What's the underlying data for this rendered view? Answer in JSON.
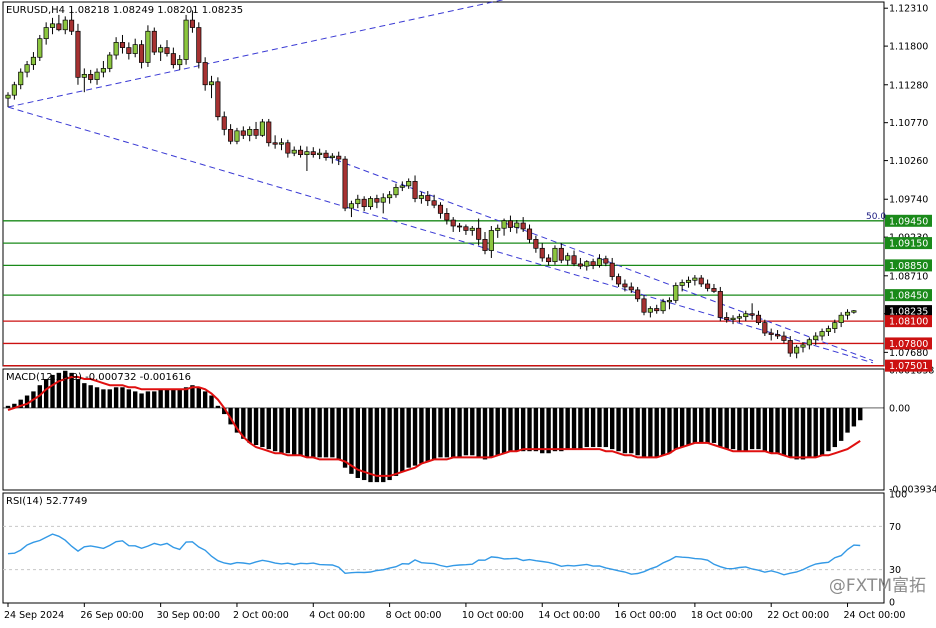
{
  "colors": {
    "background": "#ffffff",
    "frame": "#000000",
    "grid": "#c8c8c8",
    "bull_candle": "#8cc63f",
    "bear_candle": "#a63232",
    "wick": "#000000",
    "trend_channel": "#3a3ad4",
    "support_line": "#1a8a1a",
    "resistance_line": "#cc1111",
    "macd_hist": "#000000",
    "macd_signal": "#e01010",
    "rsi_line": "#3399e6",
    "tag_green": "#1a8a1a",
    "tag_red": "#cc1111",
    "tag_dark": "#000000"
  },
  "main_panel": {
    "header": "EURUSD,H4  1.08218 1.08249 1.08201 1.08235",
    "fib_label": "50.0",
    "ylim": [
      1.0751,
      1.1238
    ]
  },
  "macd_panel": {
    "header": "MACD(12,26,9) -0.000732 -0.001616",
    "axis_labels": [
      "0.001838",
      "0.00",
      "-0.003934"
    ]
  },
  "rsi_panel": {
    "header": "RSI(14) 52.7749",
    "axis_labels": [
      "100",
      "70",
      "30",
      "0"
    ]
  },
  "price_axis_labels": [
    "1.12310",
    "1.11800",
    "1.11280",
    "1.10770",
    "1.10260",
    "1.09740",
    "1.09230",
    "1.08710",
    "1.08200",
    "1.07680"
  ],
  "price_tags": [
    {
      "label": "1.09450",
      "style": "green"
    },
    {
      "label": "1.09150",
      "style": "green"
    },
    {
      "label": "1.08850",
      "style": "green"
    },
    {
      "label": "1.08450",
      "style": "green"
    },
    {
      "label": "1.08235",
      "style": "dark"
    },
    {
      "label": "1.08100",
      "style": "red"
    },
    {
      "label": "1.07800",
      "style": "red"
    },
    {
      "label": "1.07501",
      "style": "red"
    }
  ],
  "time_labels": [
    "24 Sep 2024",
    "26 Sep 00:00",
    "30 Sep 00:00",
    "2 Oct 00:00",
    "4 Oct 00:00",
    "8 Oct 00:00",
    "10 Oct 00:00",
    "14 Oct 00:00",
    "16 Oct 00:00",
    "18 Oct 00:00",
    "22 Oct 00:00",
    "24 Oct 00:00"
  ],
  "watermark": "@FXTM富拓",
  "chart_data": {
    "type": "candlestick",
    "symbol": "EURUSD",
    "timeframe": "H4",
    "levels": {
      "green": [
        1.0945,
        1.0915,
        1.0885,
        1.0845
      ],
      "red": [
        1.081,
        1.078,
        1.07501
      ]
    },
    "trend_channel": {
      "upper_start": [
        0,
        1.0902
      ],
      "upper_slope": -0.000159,
      "lower_start": [
        0,
        1.1098
      ],
      "lower_slope": -0.000253,
      "support_line_start": [
        0,
        1.1098
      ],
      "support_line_end": [
        82,
        1.125
      ]
    },
    "candles": [
      [
        1.111,
        1.1118,
        1.1098,
        1.1114
      ],
      [
        1.1114,
        1.1132,
        1.1108,
        1.1128
      ],
      [
        1.1128,
        1.115,
        1.1122,
        1.1145
      ],
      [
        1.1145,
        1.116,
        1.1138,
        1.1155
      ],
      [
        1.1155,
        1.1172,
        1.1148,
        1.1165
      ],
      [
        1.1165,
        1.1195,
        1.116,
        1.119
      ],
      [
        1.119,
        1.1212,
        1.1182,
        1.1205
      ],
      [
        1.1205,
        1.1218,
        1.1196,
        1.121
      ],
      [
        1.121,
        1.1222,
        1.12,
        1.1202
      ],
      [
        1.1202,
        1.122,
        1.1196,
        1.1215
      ],
      [
        1.1215,
        1.1228,
        1.1195,
        1.12
      ],
      [
        1.12,
        1.121,
        1.1128,
        1.1138
      ],
      [
        1.1138,
        1.115,
        1.1118,
        1.1142
      ],
      [
        1.1142,
        1.1148,
        1.113,
        1.1135
      ],
      [
        1.1135,
        1.115,
        1.1128,
        1.1145
      ],
      [
        1.1145,
        1.116,
        1.1138,
        1.115
      ],
      [
        1.115,
        1.1172,
        1.1145,
        1.1168
      ],
      [
        1.1168,
        1.1192,
        1.1162,
        1.1185
      ],
      [
        1.1185,
        1.1195,
        1.117,
        1.1178
      ],
      [
        1.1178,
        1.1185,
        1.1162,
        1.117
      ],
      [
        1.117,
        1.119,
        1.1165,
        1.1182
      ],
      [
        1.1182,
        1.1188,
        1.115,
        1.1158
      ],
      [
        1.1158,
        1.1208,
        1.1152,
        1.12
      ],
      [
        1.12,
        1.1205,
        1.1168,
        1.1172
      ],
      [
        1.1172,
        1.1182,
        1.116,
        1.1178
      ],
      [
        1.1178,
        1.1188,
        1.1166,
        1.117
      ],
      [
        1.117,
        1.1178,
        1.115,
        1.1155
      ],
      [
        1.1155,
        1.1168,
        1.1148,
        1.1162
      ],
      [
        1.1162,
        1.1222,
        1.1155,
        1.1215
      ],
      [
        1.1215,
        1.1228,
        1.1198,
        1.1205
      ],
      [
        1.1205,
        1.1212,
        1.115,
        1.1158
      ],
      [
        1.1158,
        1.1165,
        1.112,
        1.1128
      ],
      [
        1.1128,
        1.114,
        1.111,
        1.1132
      ],
      [
        1.1132,
        1.1138,
        1.108,
        1.1085
      ],
      [
        1.1085,
        1.1092,
        1.106,
        1.1068
      ],
      [
        1.1068,
        1.1075,
        1.1048,
        1.1052
      ],
      [
        1.1052,
        1.107,
        1.1048,
        1.1066
      ],
      [
        1.1066,
        1.1072,
        1.1055,
        1.106
      ],
      [
        1.106,
        1.1072,
        1.1052,
        1.1068
      ],
      [
        1.1068,
        1.1078,
        1.1055,
        1.106
      ],
      [
        1.106,
        1.1082,
        1.1058,
        1.1078
      ],
      [
        1.1078,
        1.1082,
        1.1045,
        1.105
      ],
      [
        1.105,
        1.106,
        1.1042,
        1.1048
      ],
      [
        1.1048,
        1.1056,
        1.104,
        1.105
      ],
      [
        1.105,
        1.1054,
        1.103,
        1.1036
      ],
      [
        1.1036,
        1.1045,
        1.1032,
        1.104
      ],
      [
        1.104,
        1.1046,
        1.103,
        1.1034
      ],
      [
        1.1034,
        1.1045,
        1.1012,
        1.1038
      ],
      [
        1.1038,
        1.1044,
        1.103,
        1.1034
      ],
      [
        1.1034,
        1.1042,
        1.1028,
        1.1036
      ],
      [
        1.1036,
        1.104,
        1.1026,
        1.103
      ],
      [
        1.103,
        1.1036,
        1.1022,
        1.1032
      ],
      [
        1.1032,
        1.1038,
        1.102,
        1.1028
      ],
      [
        1.1028,
        1.1032,
        1.0958,
        1.0962
      ],
      [
        1.0962,
        1.0972,
        1.095,
        1.0968
      ],
      [
        1.0968,
        1.098,
        1.0962,
        1.0974
      ],
      [
        1.0974,
        1.0978,
        1.0958,
        1.0964
      ],
      [
        1.0964,
        1.0978,
        1.096,
        1.0975
      ],
      [
        1.0975,
        1.098,
        1.0962,
        1.097
      ],
      [
        1.097,
        1.0982,
        1.0955,
        1.0976
      ],
      [
        1.0976,
        1.0985,
        1.0968,
        1.098
      ],
      [
        1.098,
        1.0995,
        1.0976,
        1.099
      ],
      [
        1.099,
        1.0998,
        1.0985,
        1.0992
      ],
      [
        1.0992,
        1.1002,
        1.0988,
        1.0998
      ],
      [
        1.0998,
        1.1006,
        1.097,
        1.0975
      ],
      [
        1.0975,
        1.0984,
        1.0968,
        1.0979
      ],
      [
        1.0979,
        1.0985,
        1.0965,
        1.0972
      ],
      [
        1.0972,
        1.098,
        1.0962,
        1.0966
      ],
      [
        1.0966,
        1.097,
        1.0948,
        1.0955
      ],
      [
        1.0955,
        1.0962,
        1.094,
        1.0946
      ],
      [
        1.0946,
        1.095,
        1.093,
        1.0938
      ],
      [
        1.0938,
        1.0942,
        1.093,
        1.0937
      ],
      [
        1.0937,
        1.094,
        1.0926,
        1.0932
      ],
      [
        1.0932,
        1.0938,
        1.0925,
        1.0935
      ],
      [
        1.0935,
        1.0948,
        1.0912,
        1.092
      ],
      [
        1.092,
        1.093,
        1.09,
        1.0905
      ],
      [
        1.0905,
        1.0938,
        1.0895,
        1.0932
      ],
      [
        1.0932,
        1.094,
        1.0922,
        1.0935
      ],
      [
        1.0935,
        1.0948,
        1.0925,
        1.0945
      ],
      [
        1.0945,
        1.0952,
        1.093,
        1.0936
      ],
      [
        1.0936,
        1.0946,
        1.0928,
        1.0942
      ],
      [
        1.0942,
        1.095,
        1.093,
        1.0934
      ],
      [
        1.0934,
        1.094,
        1.0915,
        1.092
      ],
      [
        1.092,
        1.0925,
        1.0902,
        1.0908
      ],
      [
        1.0908,
        1.0915,
        1.089,
        1.0895
      ],
      [
        1.0895,
        1.09,
        1.0885,
        1.089
      ],
      [
        1.089,
        1.0912,
        1.0886,
        1.0908
      ],
      [
        1.0908,
        1.0915,
        1.0888,
        1.0892
      ],
      [
        1.0892,
        1.0902,
        1.0885,
        1.0898
      ],
      [
        1.0898,
        1.0905,
        1.0884,
        1.0887
      ],
      [
        1.0887,
        1.0895,
        1.088,
        1.0884
      ],
      [
        1.0884,
        1.0892,
        1.0878,
        1.089
      ],
      [
        1.089,
        1.0894,
        1.088,
        1.0885
      ],
      [
        1.0885,
        1.09,
        1.0882,
        1.0894
      ],
      [
        1.0894,
        1.0898,
        1.0884,
        1.0888
      ],
      [
        1.0888,
        1.0895,
        1.0865,
        1.087
      ],
      [
        1.087,
        1.0874,
        1.0856,
        1.086
      ],
      [
        1.086,
        1.0866,
        1.085,
        1.0856
      ],
      [
        1.0856,
        1.0862,
        1.0848,
        1.0852
      ],
      [
        1.0852,
        1.0856,
        1.0836,
        1.084
      ],
      [
        1.084,
        1.0845,
        1.0818,
        1.0822
      ],
      [
        1.0822,
        1.083,
        1.0815,
        1.0827
      ],
      [
        1.0827,
        1.0832,
        1.082,
        1.0824
      ],
      [
        1.0824,
        1.084,
        1.082,
        1.0836
      ],
      [
        1.0836,
        1.0842,
        1.0826,
        1.0838
      ],
      [
        1.0838,
        1.0862,
        1.0834,
        1.0858
      ],
      [
        1.0858,
        1.0866,
        1.085,
        1.0862
      ],
      [
        1.0862,
        1.087,
        1.0855,
        1.0865
      ],
      [
        1.0865,
        1.0872,
        1.0858,
        1.0868
      ],
      [
        1.0868,
        1.0872,
        1.0856,
        1.086
      ],
      [
        1.086,
        1.0866,
        1.085,
        1.0854
      ],
      [
        1.0854,
        1.086,
        1.0848,
        1.085
      ],
      [
        1.085,
        1.0856,
        1.081,
        1.0815
      ],
      [
        1.0815,
        1.0822,
        1.0808,
        1.0812
      ],
      [
        1.0812,
        1.0818,
        1.0806,
        1.0814
      ],
      [
        1.0814,
        1.082,
        1.0808,
        1.0816
      ],
      [
        1.0816,
        1.0824,
        1.081,
        1.082
      ],
      [
        1.082,
        1.0834,
        1.0812,
        1.0818
      ],
      [
        1.0818,
        1.0824,
        1.0805,
        1.0808
      ],
      [
        1.0808,
        1.0812,
        1.079,
        1.0794
      ],
      [
        1.0794,
        1.08,
        1.0784,
        1.0792
      ],
      [
        1.0792,
        1.0798,
        1.0786,
        1.079
      ],
      [
        1.079,
        1.0796,
        1.078,
        1.0784
      ],
      [
        1.0784,
        1.079,
        1.0762,
        1.0767
      ],
      [
        1.0767,
        1.0778,
        1.076,
        1.0775
      ],
      [
        1.0775,
        1.0782,
        1.0768,
        1.0778
      ],
      [
        1.0778,
        1.0788,
        1.0772,
        1.0785
      ],
      [
        1.0785,
        1.0795,
        1.0778,
        1.079
      ],
      [
        1.079,
        1.08,
        1.0784,
        1.0796
      ],
      [
        1.0796,
        1.0804,
        1.079,
        1.08
      ],
      [
        1.08,
        1.0812,
        1.0794,
        1.0808
      ],
      [
        1.0808,
        1.0822,
        1.0802,
        1.0818
      ],
      [
        1.0818,
        1.0826,
        1.0812,
        1.0822
      ],
      [
        1.0822,
        1.0825,
        1.082,
        1.0824
      ]
    ],
    "macd_hist": [
      0.0001,
      0.0002,
      0.0004,
      0.0006,
      0.0008,
      0.0011,
      0.0014,
      0.0016,
      0.0017,
      0.0018,
      0.0017,
      0.0014,
      0.0012,
      0.0011,
      0.001,
      0.0009,
      0.0009,
      0.001,
      0.001,
      0.0009,
      0.0008,
      0.0007,
      0.0008,
      0.0008,
      0.0009,
      0.0009,
      0.0009,
      0.0009,
      0.001,
      0.0011,
      0.001,
      0.0008,
      0.0006,
      0.0001,
      -0.0003,
      -0.0008,
      -0.0012,
      -0.0015,
      -0.0017,
      -0.0018,
      -0.0019,
      -0.002,
      -0.0021,
      -0.0022,
      -0.0022,
      -0.0023,
      -0.0023,
      -0.0024,
      -0.0024,
      -0.0024,
      -0.0024,
      -0.0024,
      -0.0025,
      -0.0029,
      -0.0032,
      -0.0034,
      -0.0035,
      -0.0036,
      -0.0036,
      -0.0036,
      -0.0035,
      -0.0033,
      -0.0031,
      -0.0029,
      -0.0028,
      -0.0027,
      -0.0026,
      -0.0025,
      -0.0024,
      -0.0024,
      -0.0024,
      -0.0024,
      -0.0023,
      -0.0023,
      -0.0024,
      -0.0025,
      -0.0024,
      -0.0023,
      -0.0022,
      -0.0021,
      -0.0021,
      -0.0021,
      -0.0021,
      -0.0021,
      -0.0022,
      -0.0022,
      -0.0021,
      -0.0021,
      -0.002,
      -0.002,
      -0.002,
      -0.0019,
      -0.0019,
      -0.0019,
      -0.0019,
      -0.002,
      -0.0021,
      -0.0022,
      -0.0022,
      -0.0023,
      -0.0024,
      -0.0024,
      -0.0024,
      -0.0023,
      -0.0022,
      -0.002,
      -0.0019,
      -0.0018,
      -0.0017,
      -0.0017,
      -0.0017,
      -0.0017,
      -0.0019,
      -0.002,
      -0.002,
      -0.0021,
      -0.0021,
      -0.002,
      -0.002,
      -0.0021,
      -0.0022,
      -0.0022,
      -0.0023,
      -0.0024,
      -0.0025,
      -0.0025,
      -0.0024,
      -0.0024,
      -0.0023,
      -0.0021,
      -0.0019,
      -0.0016,
      -0.0012,
      -0.0009,
      -0.0006
    ],
    "macd_signal": [
      -0.0001,
      0.0,
      0.0001,
      0.0002,
      0.0004,
      0.0006,
      0.0009,
      0.0011,
      0.0013,
      0.0014,
      0.0015,
      0.0015,
      0.0014,
      0.0014,
      0.0013,
      0.0012,
      0.0011,
      0.0011,
      0.0011,
      0.001,
      0.001,
      0.0009,
      0.0009,
      0.0009,
      0.0009,
      0.0009,
      0.0009,
      0.0009,
      0.0009,
      0.001,
      0.001,
      0.0009,
      0.0007,
      0.0004,
      0.0,
      -0.0005,
      -0.001,
      -0.0014,
      -0.0017,
      -0.0019,
      -0.002,
      -0.0021,
      -0.0022,
      -0.0022,
      -0.0023,
      -0.0023,
      -0.0023,
      -0.0024,
      -0.0024,
      -0.0025,
      -0.0025,
      -0.0025,
      -0.0025,
      -0.0026,
      -0.0028,
      -0.003,
      -0.0031,
      -0.0032,
      -0.0033,
      -0.0033,
      -0.0033,
      -0.0032,
      -0.0031,
      -0.003,
      -0.0029,
      -0.0027,
      -0.0026,
      -0.0025,
      -0.0025,
      -0.0025,
      -0.0024,
      -0.0024,
      -0.0024,
      -0.0024,
      -0.0024,
      -0.0024,
      -0.0024,
      -0.0023,
      -0.0022,
      -0.0021,
      -0.0021,
      -0.002,
      -0.002,
      -0.002,
      -0.002,
      -0.002,
      -0.002,
      -0.002,
      -0.002,
      -0.002,
      -0.002,
      -0.002,
      -0.002,
      -0.002,
      -0.0021,
      -0.0021,
      -0.0022,
      -0.0023,
      -0.0023,
      -0.0024,
      -0.0024,
      -0.0024,
      -0.0024,
      -0.0023,
      -0.0022,
      -0.002,
      -0.0019,
      -0.0018,
      -0.0017,
      -0.0017,
      -0.0017,
      -0.0018,
      -0.0019,
      -0.002,
      -0.0021,
      -0.0021,
      -0.0021,
      -0.0021,
      -0.0021,
      -0.0021,
      -0.0022,
      -0.0022,
      -0.0023,
      -0.0024,
      -0.0024,
      -0.0024,
      -0.0024,
      -0.0024,
      -0.0023,
      -0.0023,
      -0.0022,
      -0.0021,
      -0.002,
      -0.0018,
      -0.0016
    ],
    "rsi": [
      44.7,
      45.2,
      48.1,
      52.8,
      55.3,
      56.9,
      59.9,
      62.9,
      60.8,
      57.2,
      51.7,
      47.1,
      51.1,
      51.9,
      50.8,
      49.6,
      52.4,
      55.8,
      56.7,
      52.1,
      52.0,
      49.7,
      51.8,
      54.3,
      52.8,
      54.3,
      50.6,
      48.7,
      55.5,
      55.7,
      50.9,
      47.9,
      42.4,
      38.2,
      36.1,
      35.1,
      36.5,
      36.1,
      35.3,
      37.1,
      38.6,
      37.6,
      36.0,
      35.3,
      35.9,
      34.6,
      35.8,
      35.5,
      36.0,
      34.6,
      34.4,
      34.3,
      32.2,
      26.6,
      27.1,
      27.5,
      27.3,
      27.8,
      29.2,
      29.8,
      31.4,
      32.7,
      35.5,
      35.2,
      39.0,
      36.4,
      35.9,
      35.6,
      33.8,
      32.6,
      33.7,
      34.3,
      34.5,
      35.0,
      38.8,
      38.7,
      41.8,
      41.2,
      39.9,
      40.1,
      40.5,
      38.4,
      39.3,
      38.2,
      37.5,
      36.7,
      35.1,
      33.1,
      33.9,
      33.4,
      34.1,
      34.8,
      33.2,
      33.3,
      31.6,
      30.3,
      28.9,
      27.8,
      25.7,
      26.4,
      28.1,
      30.7,
      32.7,
      36.2,
      38.7,
      42.0,
      41.5,
      41.1,
      40.2,
      39.9,
      38.7,
      34.9,
      32.7,
      30.9,
      30.8,
      31.9,
      32.5,
      30.6,
      29.4,
      27.6,
      28.9,
      27.3,
      25.2,
      26.7,
      27.8,
      30.0,
      32.9,
      35.2,
      36.1,
      36.8,
      41.0,
      43.0,
      48.6,
      52.7,
      52.3
    ]
  }
}
